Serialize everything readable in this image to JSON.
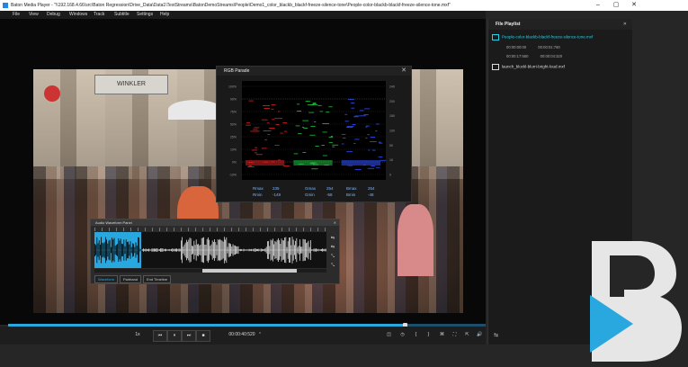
{
  "window": {
    "title": "Baton Media Player - \"\\\\192.168.4.66\\src\\Baton Regression\\Drive_Data\\Data1\\TestStreams\\BatonDemoStreams\\People\\Demo1_color_blackb_blackf-freeze-silence-tone\\People-color-blackb-blackf-freeze-silence-tone.mxf\"",
    "minimize": "–",
    "maximize": "▢",
    "close": "✕"
  },
  "menu": [
    "File",
    "View",
    "Debug",
    "Windows",
    "Track",
    "Subtitle",
    "Settings",
    "Help"
  ],
  "video": {
    "sign_text": "WINKLER"
  },
  "rgb_parade": {
    "title": "RGB Parade",
    "close": "✕",
    "left_ticks": [
      "100%",
      "90%",
      "75%",
      "50%",
      "25%",
      "10%",
      "0%",
      "-10%"
    ],
    "right_ticks": [
      "240",
      "200",
      "150",
      "100",
      "50",
      "16",
      "0"
    ],
    "stats": {
      "rmax_label": "Rmax",
      "rmax": "235",
      "gmax_label": "Gmax",
      "gmax": "254",
      "bmax_label": "Bmax",
      "bmax": "254",
      "rmin_label": "Rmin",
      "rmin": "-149",
      "gmin_label": "Gmin",
      "gmin": "-58",
      "bmin_label": "Bmin",
      "bmin": "-48"
    },
    "colors": {
      "red": "#e02020",
      "green": "#20c040",
      "blue": "#3050ff",
      "grid": "#00a090"
    }
  },
  "audio_waveform": {
    "title": "Audio Waveform Panel",
    "close": "✕",
    "tabs": [
      "Waveform",
      "Pairband",
      "End Timeline"
    ],
    "side_buttons": [
      "⇆",
      "⇆",
      "⤡",
      "⤡"
    ],
    "accent": "#29a8e0"
  },
  "playback": {
    "progress_fraction": 0.83,
    "speed": "1x",
    "prev": "⏮",
    "pause": "⏸",
    "next": "⏭",
    "stop": "■",
    "timecode": "00:00:40:520",
    "timecode_caret": "⌃",
    "right_controls": [
      "◫",
      "◷",
      "{",
      "}",
      "⌘",
      "⛶",
      "⇱",
      "⇅",
      "🔊"
    ]
  },
  "playlist": {
    "title": "File Playlist",
    "close": "✕",
    "items": [
      {
        "name": "People-color-blackb-blackf-freeze-silence-tone.mxf",
        "active": true,
        "start": "00:00:00:00",
        "end": "00:00:01:760",
        "start2": "00:00:17:560",
        "end2": "00:00:04:320"
      },
      {
        "name": "launch_blockl-blurri-bright-loud.mxf",
        "active": false
      }
    ],
    "bottom_icon": "⇆"
  },
  "logo": {
    "letter": "B",
    "colors": {
      "main": "#e8e8e8",
      "accent": "#29a8e0"
    }
  }
}
